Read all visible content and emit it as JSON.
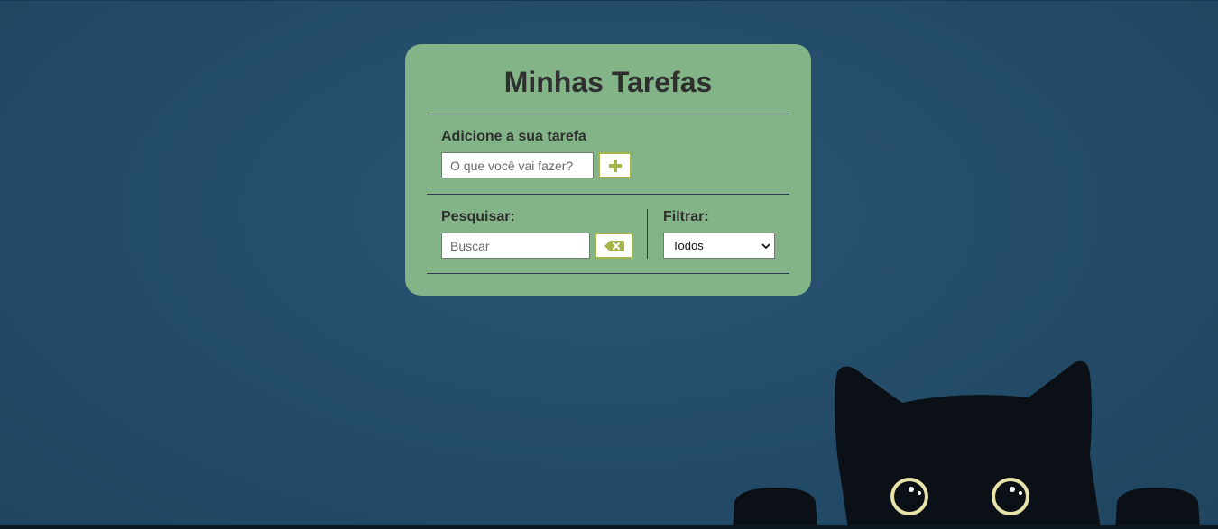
{
  "todo": {
    "title": "Minhas Tarefas",
    "add_section": {
      "label": "Adicione a sua tarefa",
      "input_placeholder": "O que você vai fazer?",
      "input_value": "",
      "add_button_icon": "plus-icon"
    },
    "search_section": {
      "label": "Pesquisar:",
      "input_placeholder": "Buscar",
      "input_value": "",
      "clear_button_icon": "backspace-icon"
    },
    "filter_section": {
      "label": "Filtrar:",
      "selected": "Todos"
    }
  },
  "colors": {
    "background": "#244d6a",
    "card": "#82b487",
    "button_border": "#a6b24a",
    "icon": "#a6b24a",
    "cat": "#0b0f16",
    "cat_eyes": "#e8e3a8"
  }
}
